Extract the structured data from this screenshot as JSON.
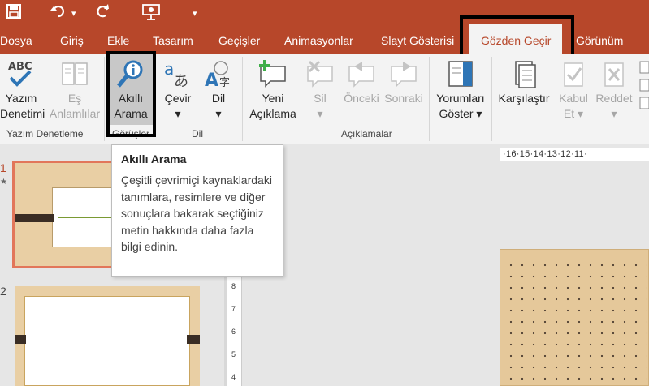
{
  "quick_access": {
    "items": [
      "save-icon",
      "undo-icon",
      "redo-icon",
      "slideshow-icon",
      "customize-icon"
    ],
    "undo_dropdown": "▾",
    "customize": "▾"
  },
  "tabs": [
    {
      "label": "Dosya"
    },
    {
      "label": "Giriş"
    },
    {
      "label": "Ekle"
    },
    {
      "label": "Tasarım"
    },
    {
      "label": "Geçişler"
    },
    {
      "label": "Animasyonlar"
    },
    {
      "label": "Slayt Gösterisi"
    },
    {
      "label": "Gözden Geçir",
      "active": true
    },
    {
      "label": "Görünüm"
    }
  ],
  "ribbon": {
    "buttons": [
      {
        "line1": "Yazım",
        "line2": "Denetimi",
        "icon": "spellcheck-icon",
        "enabled": true
      },
      {
        "line1": "Eş",
        "line2": "Anlamlılar",
        "icon": "thesaurus-icon",
        "enabled": false
      },
      {
        "line1": "Akıllı",
        "line2": "Arama",
        "icon": "smart-lookup-icon",
        "enabled": true
      },
      {
        "line1": "Çevir",
        "line2": "▾",
        "icon": "translate-icon",
        "enabled": true
      },
      {
        "line1": "Dil",
        "line2": "▾",
        "icon": "language-icon",
        "enabled": true
      },
      {
        "line1": "Yeni",
        "line2": "Açıklama",
        "icon": "new-comment-icon",
        "enabled": true
      },
      {
        "line1": "Sil",
        "line2": "▾",
        "icon": "delete-comment-icon",
        "enabled": false
      },
      {
        "line1": "Önceki",
        "line2": "",
        "icon": "previous-comment-icon",
        "enabled": false
      },
      {
        "line1": "Sonraki",
        "line2": "",
        "icon": "next-comment-icon",
        "enabled": false
      },
      {
        "line1": "Yorumları",
        "line2": "Göster ▾",
        "icon": "show-comments-icon",
        "enabled": true
      },
      {
        "line1": "Karşılaştır",
        "line2": "",
        "icon": "compare-icon",
        "enabled": true
      },
      {
        "line1": "Kabul",
        "line2": "Et ▾",
        "icon": "accept-icon",
        "enabled": false
      },
      {
        "line1": "Reddet",
        "line2": "▾",
        "icon": "reject-icon",
        "enabled": false
      }
    ],
    "groups": [
      {
        "label": "Yazım Denetleme"
      },
      {
        "label": "Görüşler"
      },
      {
        "label": "Dil"
      },
      {
        "label": "Açıklamalar"
      }
    ]
  },
  "tooltip": {
    "title": "Akıllı Arama",
    "body": "Çeşitli çevrimiçi kaynaklardaki tanımlara, resimlere ve diğer sonuçlara bakarak seçtiğiniz metin hakkında daha fazla bilgi edinin."
  },
  "slides": [
    {
      "number": "1",
      "marker": "★"
    },
    {
      "number": "2"
    }
  ],
  "ruler": {
    "horizontal": "·16·15·14·13·12·11·",
    "vertical": [
      "8",
      "7",
      "6",
      "5",
      "4"
    ]
  },
  "colors": {
    "accent": "#b7472a",
    "ribbon": "#f3f3f3",
    "slide_bg": "#e5c89a"
  }
}
